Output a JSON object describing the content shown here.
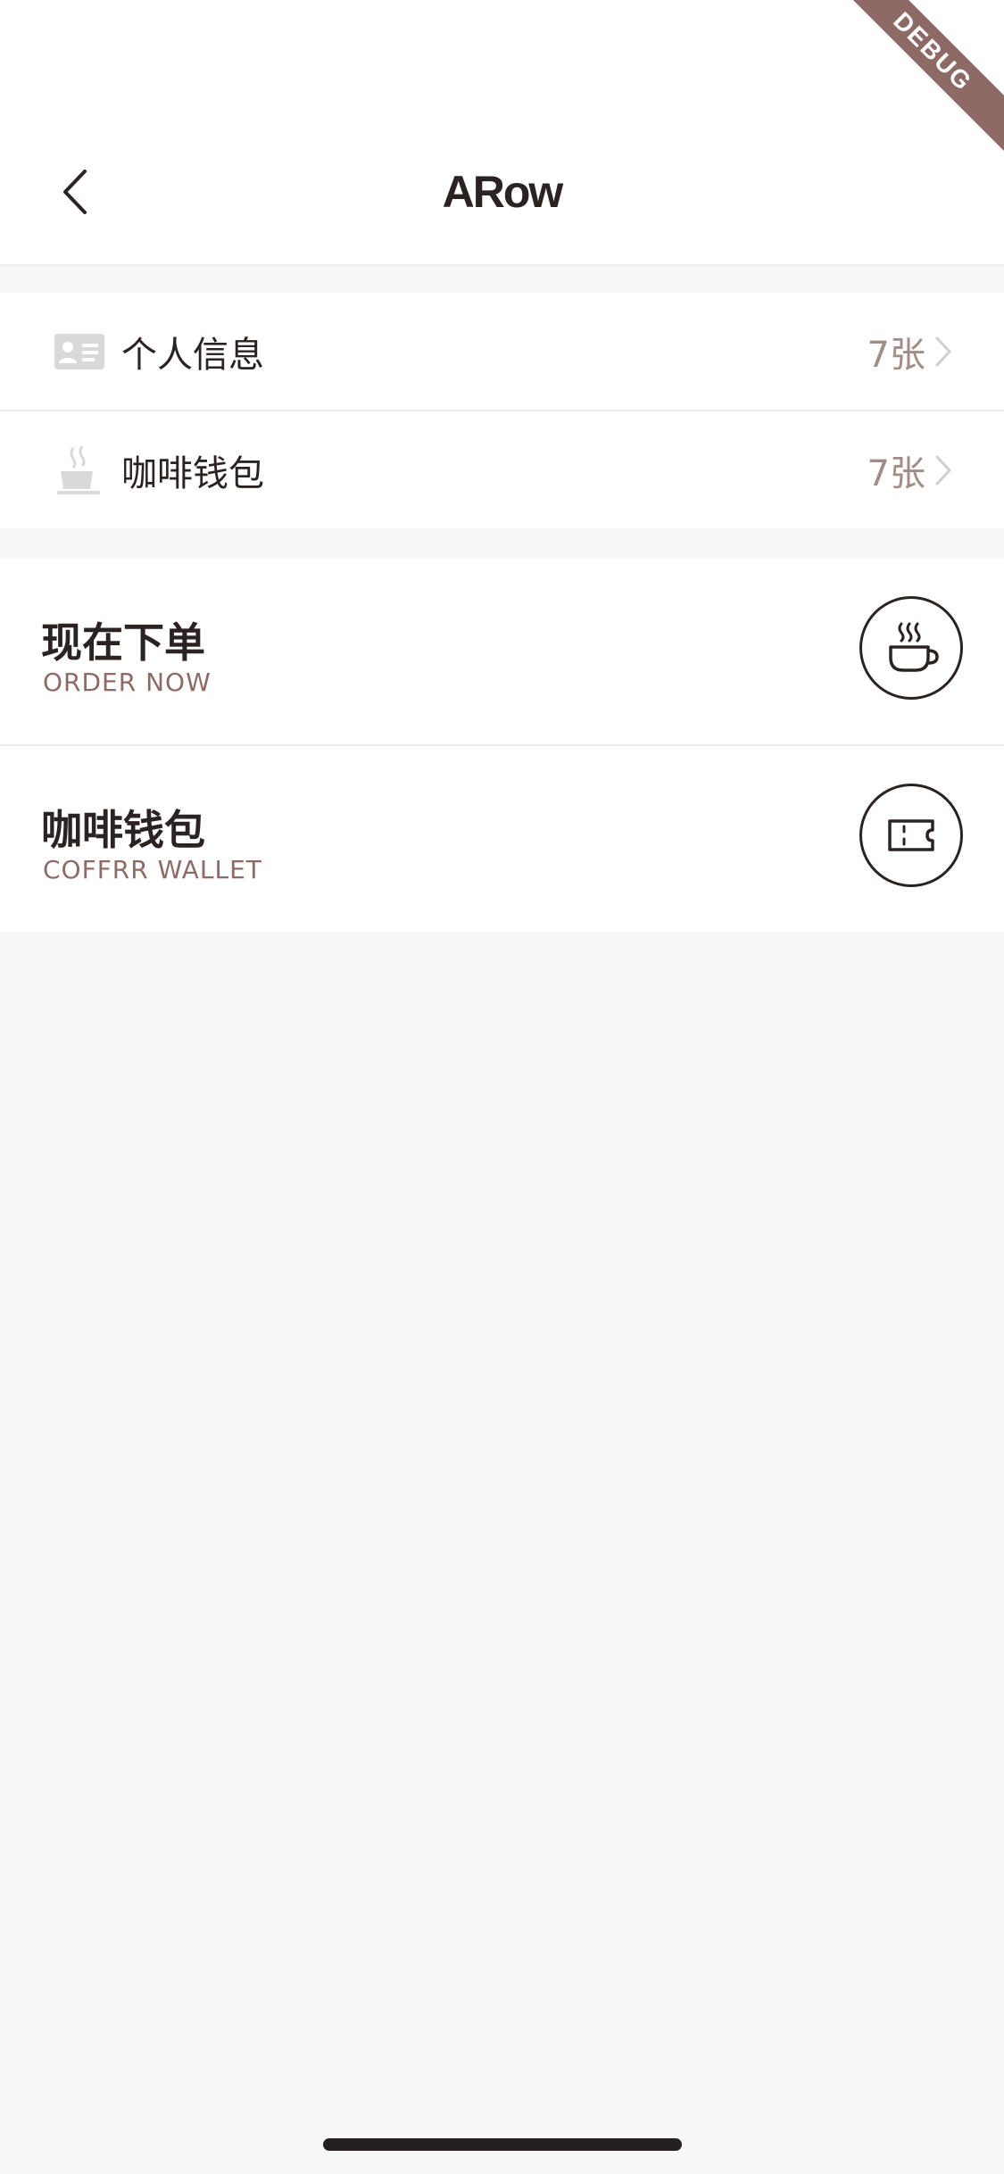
{
  "header": {
    "title": "ARow",
    "debug_banner": "DEBUG"
  },
  "list": {
    "items": [
      {
        "icon": "id-card-icon",
        "label": "个人信息",
        "count": "7张"
      },
      {
        "icon": "coffee-cup-icon",
        "label": "咖啡钱包",
        "count": "7张"
      }
    ]
  },
  "cards": [
    {
      "title": "现在下单",
      "subtitle": "ORDER NOW",
      "icon": "coffee-cup-icon"
    },
    {
      "title": "咖啡钱包",
      "subtitle": "COFFRR WALLET",
      "icon": "ticket-icon"
    }
  ],
  "colors": {
    "text_dark": "#2b2322",
    "accent_brown": "#8e6a66",
    "muted_count": "#a18c87",
    "icon_gray": "#d9d9d9",
    "background": "#f7f7f7"
  }
}
